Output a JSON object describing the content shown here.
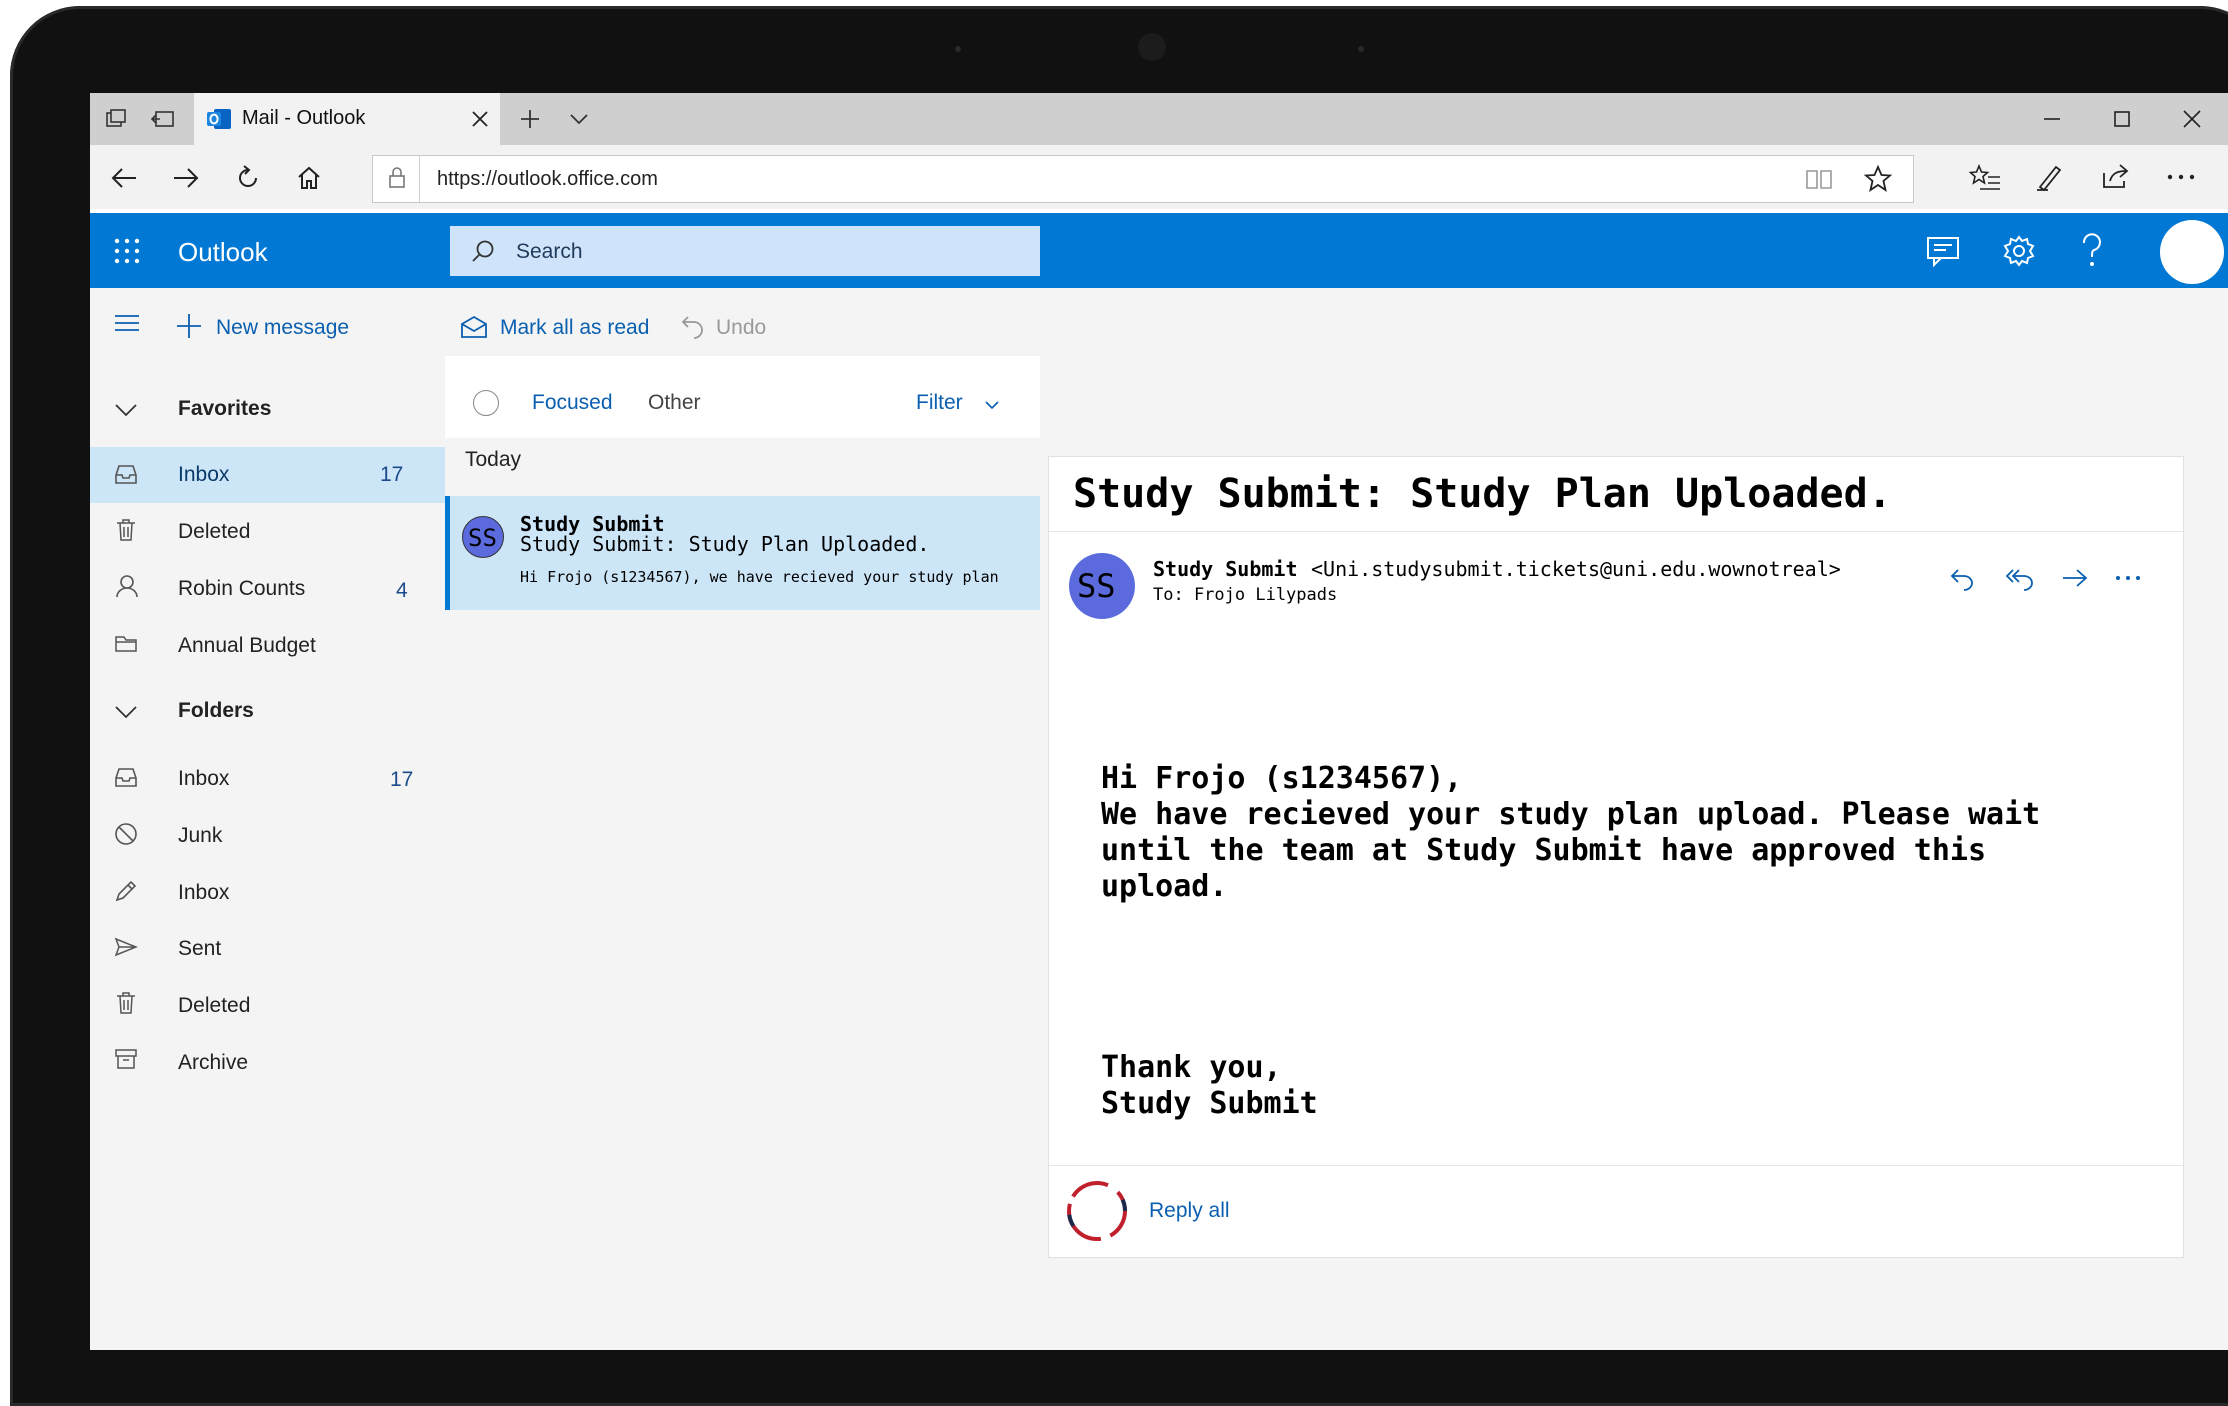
{
  "browser": {
    "tab_title": "Mail - Outlook",
    "url": "https://outlook.office.com"
  },
  "app": {
    "name": "Outlook",
    "search_placeholder": "Search"
  },
  "commands": {
    "new_message": "New message",
    "mark_all_read": "Mark all as read",
    "undo": "Undo"
  },
  "nav": {
    "favorites_header": "Favorites",
    "favorites": [
      {
        "label": "Inbox",
        "count": "17",
        "icon": "inbox-icon"
      },
      {
        "label": "Deleted",
        "count": "",
        "icon": "trash-icon"
      },
      {
        "label": "Robin Counts",
        "count": "4",
        "icon": "person-icon"
      },
      {
        "label": "Annual Budget",
        "count": "",
        "icon": "folder-icon"
      }
    ],
    "folders_header": "Folders",
    "folders": [
      {
        "label": "Inbox",
        "count": "17",
        "icon": "inbox-icon"
      },
      {
        "label": "Junk",
        "count": "",
        "icon": "block-icon"
      },
      {
        "label": "Inbox",
        "count": "",
        "icon": "pencil-icon"
      },
      {
        "label": "Sent",
        "count": "",
        "icon": "send-icon"
      },
      {
        "label": "Deleted",
        "count": "",
        "icon": "trash-icon"
      },
      {
        "label": "Archive",
        "count": "",
        "icon": "archive-icon"
      }
    ]
  },
  "list": {
    "tabs": [
      "Focused",
      "Other"
    ],
    "active_tab": "Focused",
    "filter": "Filter",
    "group_label": "Today",
    "message": {
      "avatar": "SS",
      "sender": "Study Submit",
      "subject": "Study Submit: Study Plan Uploaded.",
      "preview": "Hi Frojo (s1234567), we have recieved your study plan"
    }
  },
  "reading": {
    "subject": "Study Submit: Study Plan Uploaded.",
    "avatar": "SS",
    "from_name": "Study Submit",
    "from_email": "<Uni.studysubmit.tickets@uni.edu.wownotreal>",
    "to": "To: Frojo Lilypads",
    "body": [
      "Hi Frojo (s1234567),",
      "We have recieved your study plan upload. Please wait",
      "until the team at Study Submit have approved this",
      "upload."
    ],
    "signoff": [
      "Thank you,",
      "Study Submit"
    ],
    "reply_all": "Reply all"
  },
  "colors": {
    "brand": "#0078d4",
    "selection": "#cde6f7",
    "avatar": "#5b6bde"
  }
}
